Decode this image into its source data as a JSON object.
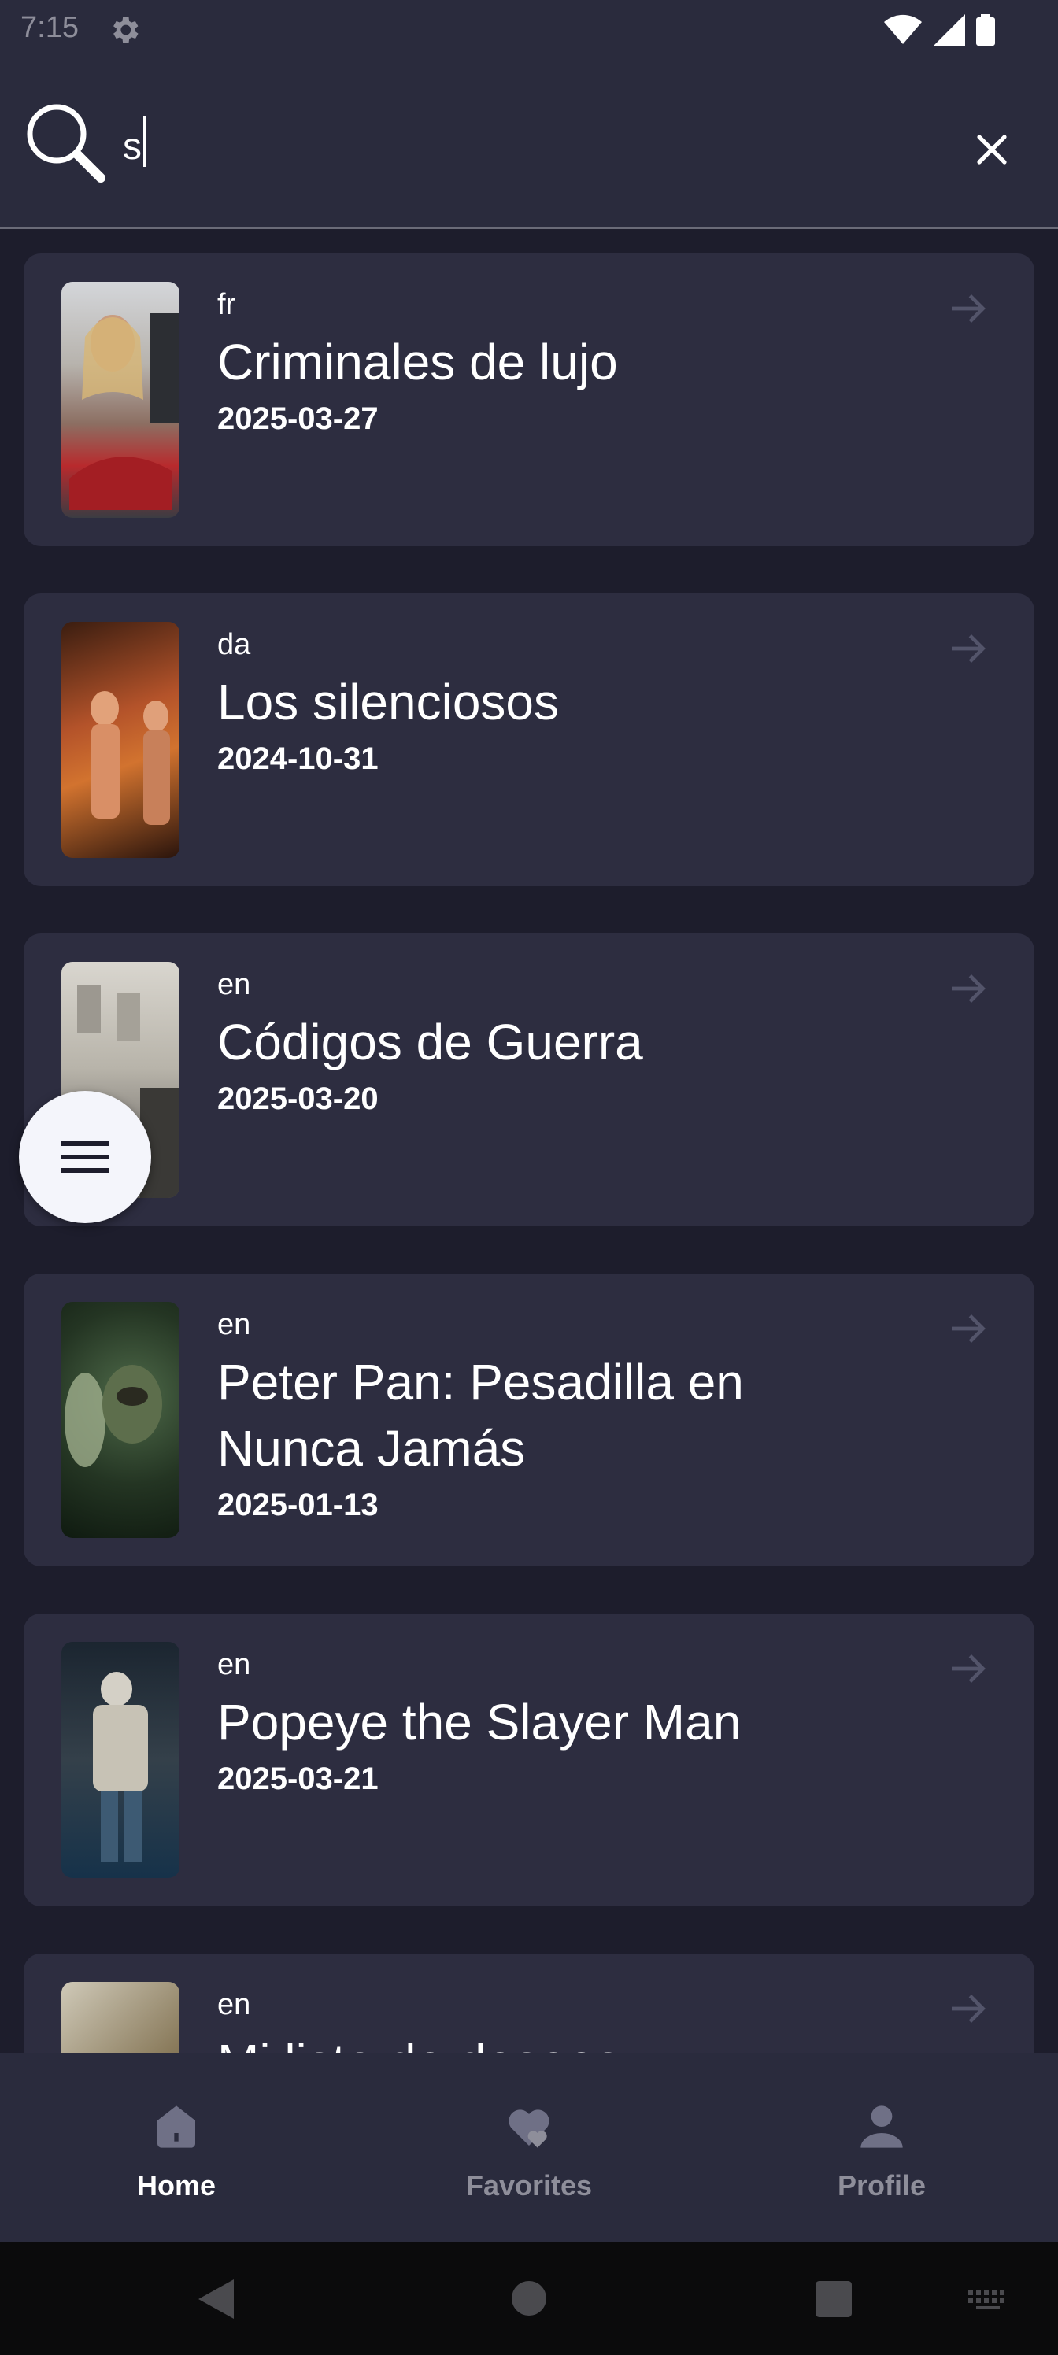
{
  "status_bar": {
    "time": "7:15"
  },
  "search": {
    "value": "s",
    "placeholder": ""
  },
  "results": [
    {
      "language": "fr",
      "title": "Criminales de lujo",
      "date": "2025-03-27"
    },
    {
      "language": "da",
      "title": "Los silenciosos",
      "date": "2024-10-31"
    },
    {
      "language": "en",
      "title": "Códigos de Guerra",
      "date": "2025-03-20"
    },
    {
      "language": "en",
      "title": "Peter Pan: Pesadilla en Nunca Jamás",
      "date": "2025-01-13"
    },
    {
      "language": "en",
      "title": "Popeye the Slayer Man",
      "date": "2025-03-21"
    },
    {
      "language": "en",
      "title": "Mi lista de deseos",
      "date": ""
    }
  ],
  "bottom_nav": {
    "items": [
      {
        "label": "Home",
        "icon": "home-icon",
        "active": true
      },
      {
        "label": "Favorites",
        "icon": "heart-icon",
        "active": false
      },
      {
        "label": "Profile",
        "icon": "person-icon",
        "active": false
      }
    ]
  },
  "colors": {
    "background": "#1d1d2c",
    "surface": "#2d2d40",
    "bar": "#2a2b3d",
    "inactive": "#8e8e9a",
    "fab": "#f4f5fb"
  }
}
